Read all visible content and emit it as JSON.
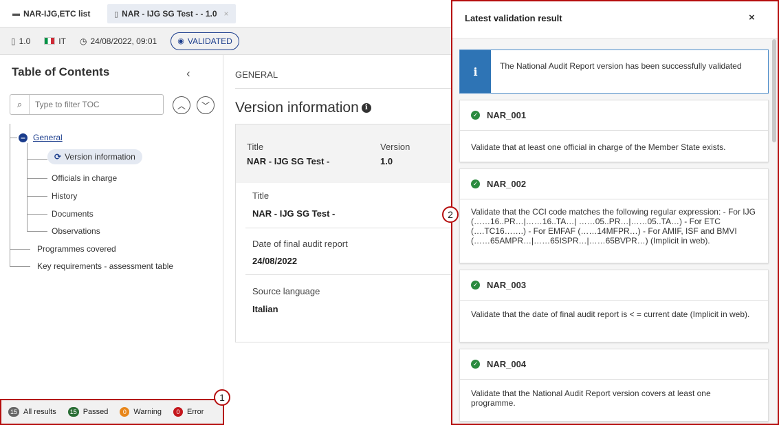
{
  "tabs": [
    {
      "label": "NAR-IJG,ETC list",
      "icon": "folder-open-icon"
    },
    {
      "label": "NAR - IJG SG Test - - 1.0",
      "icon": "document-icon",
      "close": "×"
    }
  ],
  "infobar": {
    "version": "1.0",
    "country": "IT",
    "datetime": "24/08/2022, 09:01",
    "status": "VALIDATED"
  },
  "toc": {
    "title": "Table of Contents",
    "collapse": "‹",
    "filter_placeholder": "Type to filter TOC",
    "items": [
      {
        "label": "General"
      },
      {
        "label": "Version information"
      },
      {
        "label": "Officials in charge"
      },
      {
        "label": "History"
      },
      {
        "label": "Documents"
      },
      {
        "label": "Observations"
      },
      {
        "label": "Programmes covered"
      },
      {
        "label": "Key requirements - assessment table"
      }
    ]
  },
  "footer": {
    "all": {
      "count": "15",
      "label": "All results",
      "color": "#666666"
    },
    "passed": {
      "count": "15",
      "label": "Passed",
      "color": "#2a6e35"
    },
    "warning": {
      "count": "0",
      "label": "Warning",
      "color": "#e8861a"
    },
    "error": {
      "count": "0",
      "label": "Error",
      "color": "#c4161c"
    }
  },
  "markers": [
    "1",
    "2"
  ],
  "main": {
    "section": "GENERAL",
    "heading": "Version information",
    "head_title_label": "Title",
    "head_title_value": "NAR - IJG SG Test -",
    "head_version_label": "Version",
    "head_version_value": "1.0",
    "fields": [
      {
        "label": "Title",
        "value": "NAR - IJG SG Test -"
      },
      {
        "label": "Date of final audit report",
        "value": "24/08/2022"
      },
      {
        "label": "Source language",
        "value": "Italian"
      }
    ]
  },
  "panel": {
    "title": "Latest validation result",
    "close": "×",
    "info": "The National Audit Report version has been successfully validated",
    "results": [
      {
        "code": "NAR_001",
        "text": "Validate that at least one official in charge of the Member State exists."
      },
      {
        "code": "NAR_002",
        "text": "Validate that the CCI code matches the following regular expression: - For IJG (……16..PR…|……16..TA…| ……05..PR…|……05..TA…) - For ETC (….TC16…….) - For EMFAF (……14MFPR…) - For AMIF, ISF and BMVI (……65AMPR…|……65ISPR…|……65BVPR…) (Implicit in web)."
      },
      {
        "code": "NAR_003",
        "text": "Validate that the date of final audit report is < = current date (Implicit in web)."
      },
      {
        "code": "NAR_004",
        "text": "Validate that the National Audit Report version covers at least one programme."
      }
    ]
  }
}
